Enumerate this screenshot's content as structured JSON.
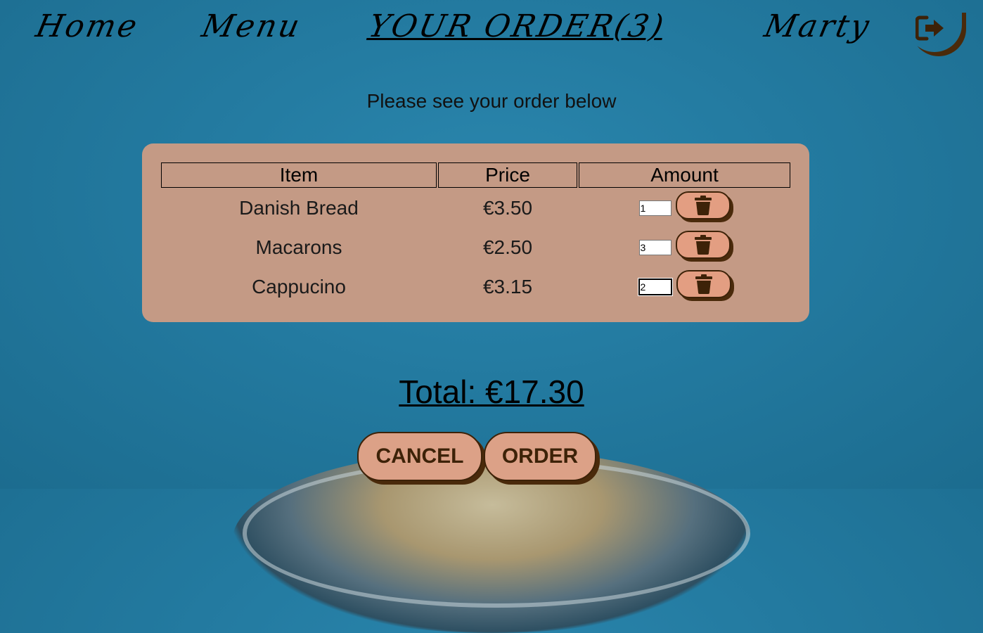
{
  "nav": {
    "home_label": "Home",
    "menu_label": "Menu",
    "order_label": "YOUR ORDER(3)",
    "user_label": "Marty",
    "logout_icon": "sign-out-icon"
  },
  "subtitle": "Please see your order below",
  "order_table": {
    "headers": {
      "item": "Item",
      "price": "Price",
      "amount": "Amount"
    },
    "rows": [
      {
        "item": "Danish Bread",
        "price": "€3.50",
        "amount": "1"
      },
      {
        "item": "Macarons",
        "price": "€2.50",
        "amount": "3"
      },
      {
        "item": "Cappucino",
        "price": "€3.15",
        "amount": "2"
      }
    ],
    "delete_icon": "trash-icon"
  },
  "total": "Total: €17.30",
  "actions": {
    "cancel_label": "CANCEL",
    "order_label": "ORDER"
  },
  "colors": {
    "background": "#237aa0",
    "card": "#c49a85",
    "button": "#dca187",
    "button_text": "#3d2208",
    "shadow": "#4a2a0b"
  }
}
